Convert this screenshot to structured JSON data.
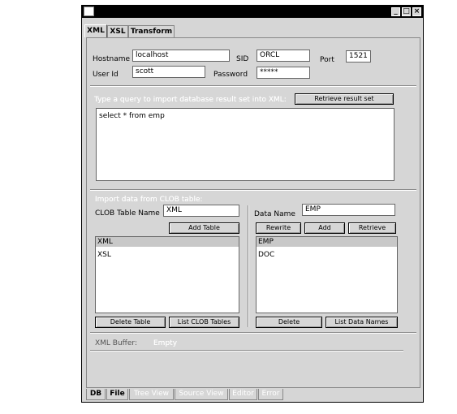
{
  "window": {
    "minimize_glyph": "_",
    "maximize_glyph": "□",
    "close_glyph": "×"
  },
  "top_tabs": [
    {
      "label": "XML"
    },
    {
      "label": "XSL"
    },
    {
      "label": "Transform"
    }
  ],
  "connection": {
    "hostname_label": "Hostname",
    "hostname_value": "localhost",
    "sid_label": "SID",
    "sid_value": "ORCL",
    "port_label": "Port",
    "port_value": "1521",
    "userid_label": "User Id",
    "userid_value": "scott",
    "password_label": "Password",
    "password_value": "*****"
  },
  "query": {
    "hint": "Type a query to import database result set into XML:",
    "retrieve_button": "Retrieve result set",
    "text": "select * from emp"
  },
  "clob": {
    "section_label": "Import data from CLOB table:",
    "table_name_label": "CLOB Table Name",
    "table_name_value": "XML",
    "add_table_button": "Add Table",
    "tables": [
      "XML",
      "XSL"
    ],
    "delete_table_button": "Delete Table",
    "list_tables_button": "List CLOB Tables",
    "data_name_label": "Data Name",
    "data_name_value": "EMP",
    "rewrite_button": "Rewrite",
    "add_button": "Add",
    "retrieve_button": "Retrieve",
    "data_names": [
      "EMP",
      "DOC"
    ],
    "delete_button": "Delete",
    "list_data_button": "List Data Names"
  },
  "buffer": {
    "label": "XML Buffer:",
    "value": "Empty"
  },
  "bottom_tabs": [
    {
      "label": "DB"
    },
    {
      "label": "File"
    },
    {
      "label": "Tree View"
    },
    {
      "label": "Source View"
    },
    {
      "label": "Editor"
    },
    {
      "label": "Error"
    }
  ]
}
